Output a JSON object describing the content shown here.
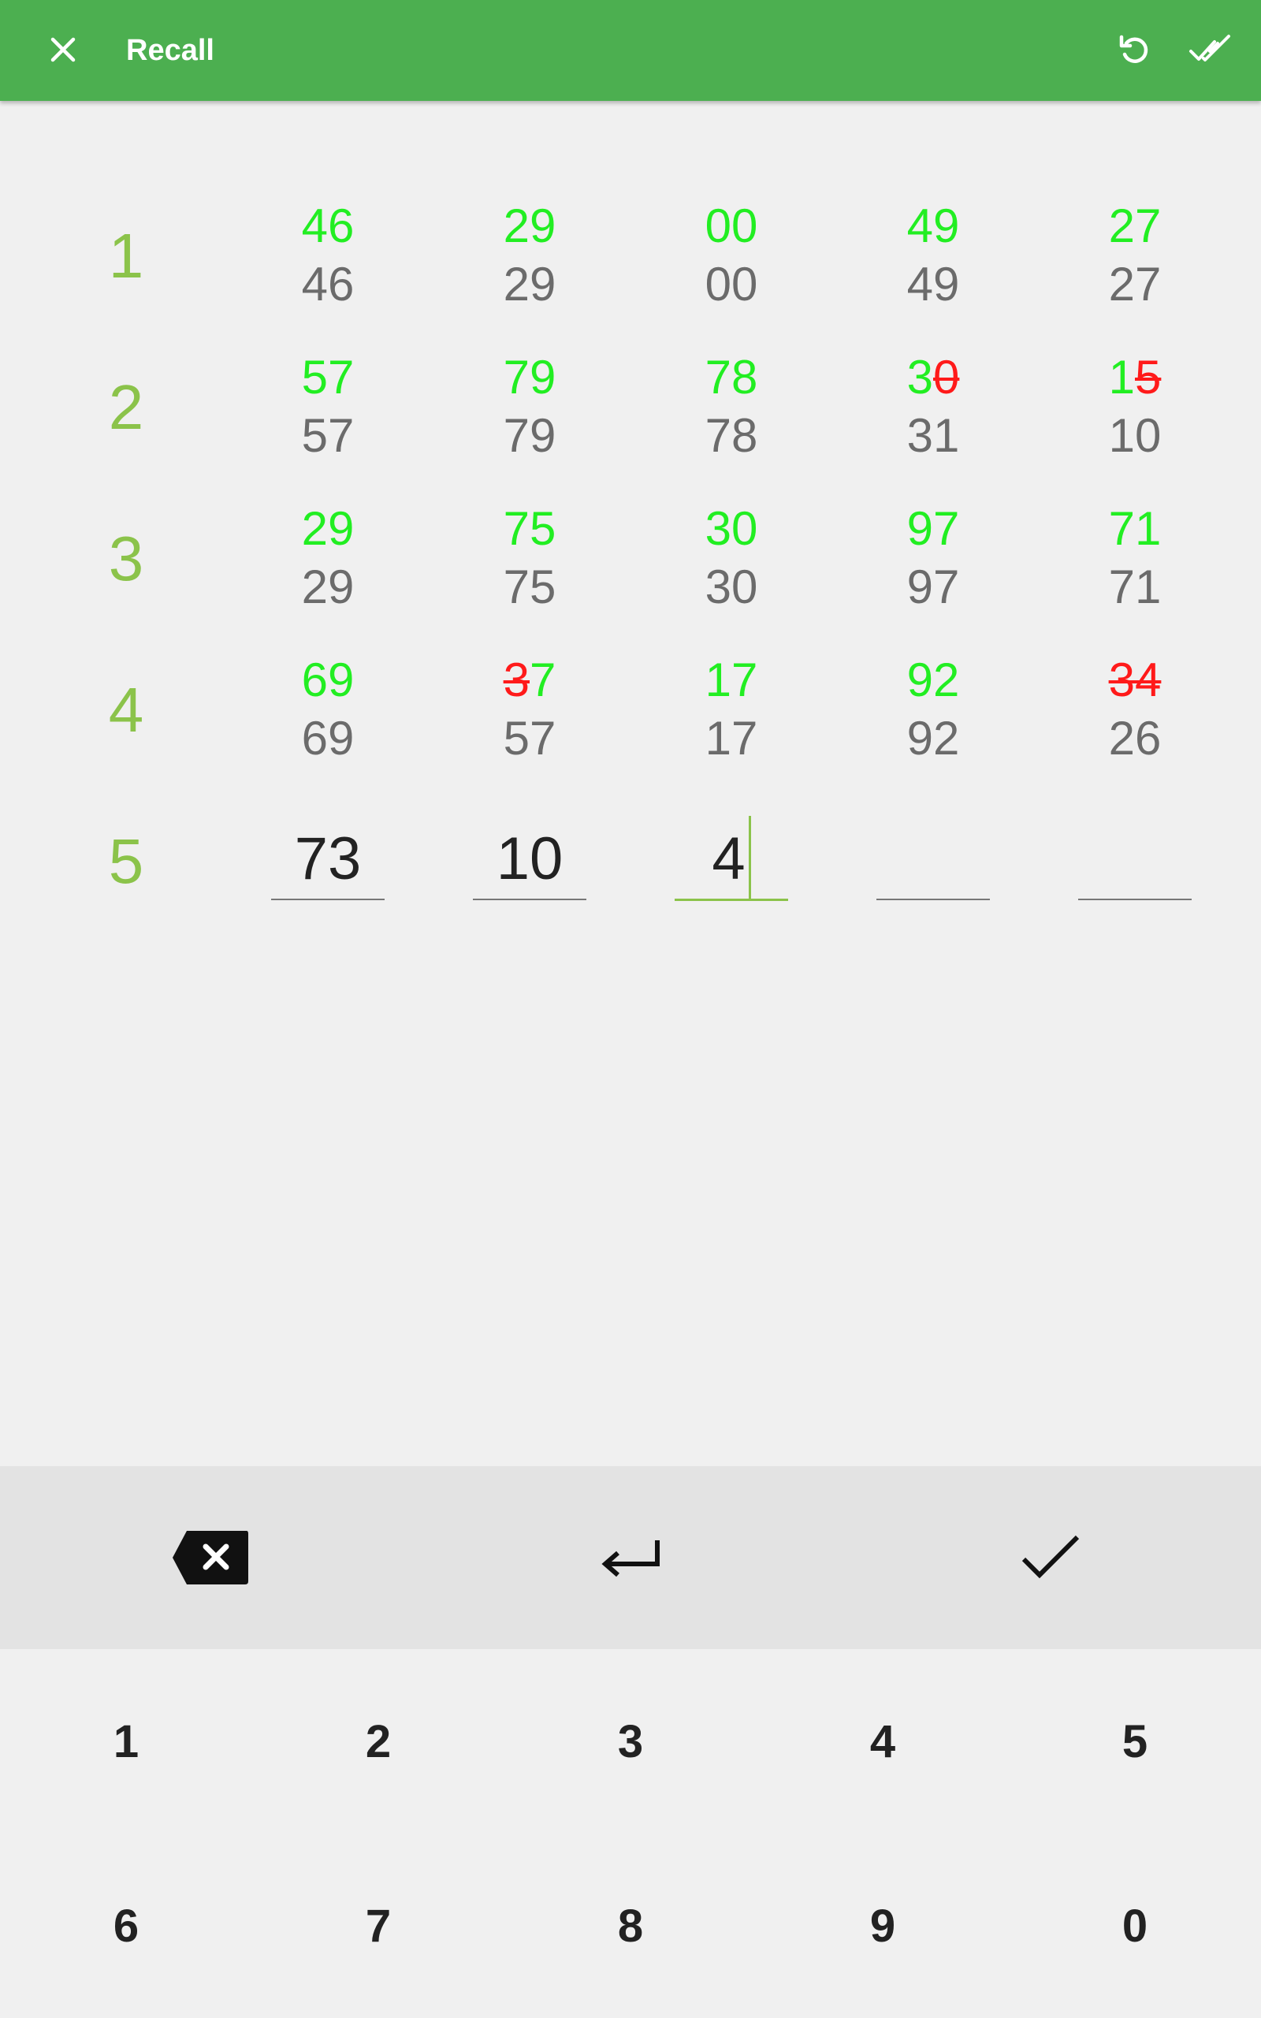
{
  "appbar": {
    "title": "Recall",
    "close_icon": "close-icon",
    "undo_icon": "undo-icon",
    "done_all_icon": "done-all-icon",
    "color": "#4caf50"
  },
  "rows": [
    {
      "label": "1",
      "cells": [
        {
          "expected": "46",
          "answer": "46"
        },
        {
          "expected": "29",
          "answer": "29"
        },
        {
          "expected": "00",
          "answer": "00"
        },
        {
          "expected": "49",
          "answer": "49"
        },
        {
          "expected": "27",
          "answer": "27"
        }
      ]
    },
    {
      "label": "2",
      "cells": [
        {
          "expected": "57",
          "answer": "57"
        },
        {
          "expected": "79",
          "answer": "79"
        },
        {
          "expected": "78",
          "answer": "78"
        },
        {
          "expected": "30",
          "answer": "31",
          "expected_ok": "3",
          "expected_wrong": "0"
        },
        {
          "expected": "15",
          "answer": "10",
          "expected_ok": "1",
          "expected_wrong": "5"
        }
      ]
    },
    {
      "label": "3",
      "cells": [
        {
          "expected": "29",
          "answer": "29"
        },
        {
          "expected": "75",
          "answer": "75"
        },
        {
          "expected": "30",
          "answer": "30"
        },
        {
          "expected": "97",
          "answer": "97"
        },
        {
          "expected": "71",
          "answer": "71"
        }
      ]
    },
    {
      "label": "4",
      "cells": [
        {
          "expected": "69",
          "answer": "69"
        },
        {
          "expected": "37",
          "answer": "57",
          "expected_wrong": "3",
          "expected_ok": "7"
        },
        {
          "expected": "17",
          "answer": "17"
        },
        {
          "expected": "92",
          "answer": "92"
        },
        {
          "expected": "34",
          "answer": "26",
          "expected_wrong": "34"
        }
      ]
    }
  ],
  "input_row": {
    "label": "5",
    "values": [
      "73",
      "10",
      "4",
      "",
      ""
    ]
  },
  "keyboard": {
    "tools": [
      "backspace-icon",
      "enter-icon",
      "check-icon"
    ],
    "keys": [
      "1",
      "2",
      "3",
      "4",
      "5",
      "6",
      "7",
      "8",
      "9",
      "0"
    ]
  },
  "colors": {
    "correct": "#22ee22",
    "wrong": "#ff1a1a",
    "answer": "#6b6b6b",
    "row_label": "#8bc34a"
  }
}
